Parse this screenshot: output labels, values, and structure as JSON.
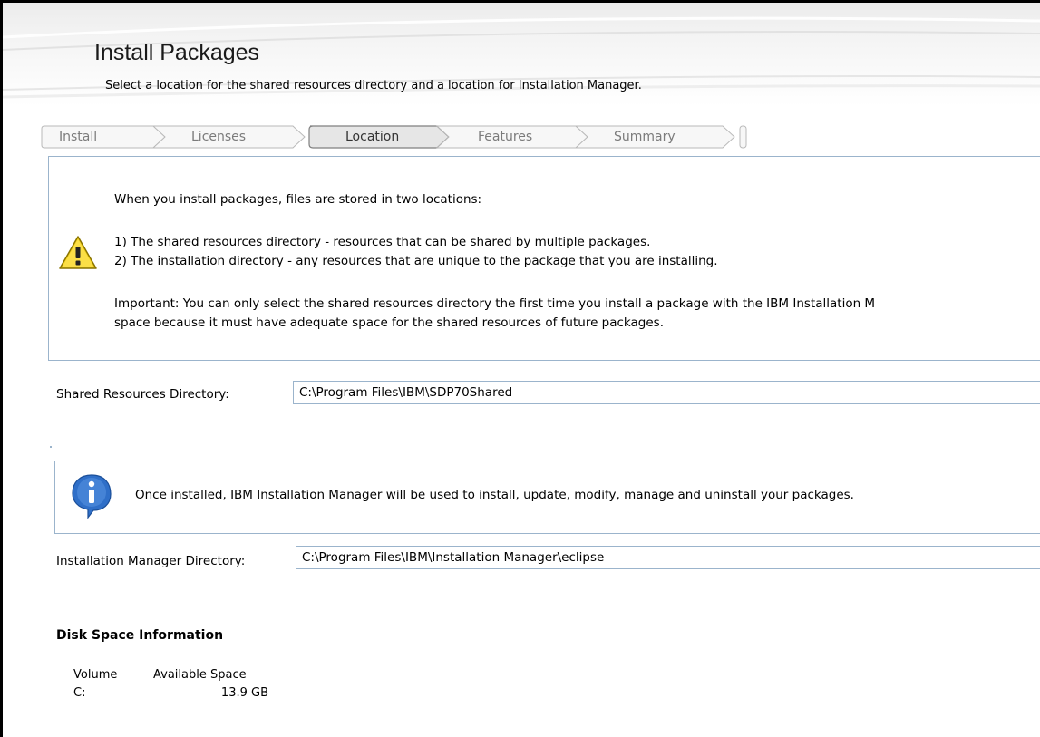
{
  "header": {
    "title": "Install Packages",
    "subtitle": "Select a location for the shared resources directory and a location for Installation Manager."
  },
  "steps": [
    {
      "label": "Install",
      "active": false
    },
    {
      "label": "Licenses",
      "active": false
    },
    {
      "label": "Location",
      "active": true
    },
    {
      "label": "Features",
      "active": false
    },
    {
      "label": "Summary",
      "active": false
    }
  ],
  "warning": {
    "icon": "warning-icon",
    "intro": "When you install packages, files are stored in two locations:",
    "item1": "1) The shared resources directory - resources that can be shared by multiple packages.",
    "item2": "2) The installation directory - any resources that are unique to the package that you are installing.",
    "important_line1": "Important: You can only select the shared resources directory the first time you install a package with the IBM Installation M",
    "important_line2": "space because it must have adequate space for the shared resources of future packages."
  },
  "shared_resources": {
    "label": "Shared Resources Directory:",
    "value": "C:\\Program Files\\IBM\\SDP70Shared"
  },
  "info": {
    "icon": "info-icon",
    "text": "Once installed, IBM Installation Manager will be used to install, update, modify, manage and uninstall your packages."
  },
  "installation_manager": {
    "label": "Installation Manager Directory:",
    "value": "C:\\Program Files\\IBM\\Installation Manager\\eclipse"
  },
  "disk_space": {
    "heading": "Disk Space Information",
    "columns": [
      "Volume",
      "Available Space"
    ],
    "rows": [
      {
        "volume": "C:",
        "available": "13.9 GB"
      }
    ]
  },
  "colors": {
    "panel_border": "#9bb4cc",
    "warning_yellow": "#f5d21e",
    "info_blue": "#2f6fc8"
  }
}
